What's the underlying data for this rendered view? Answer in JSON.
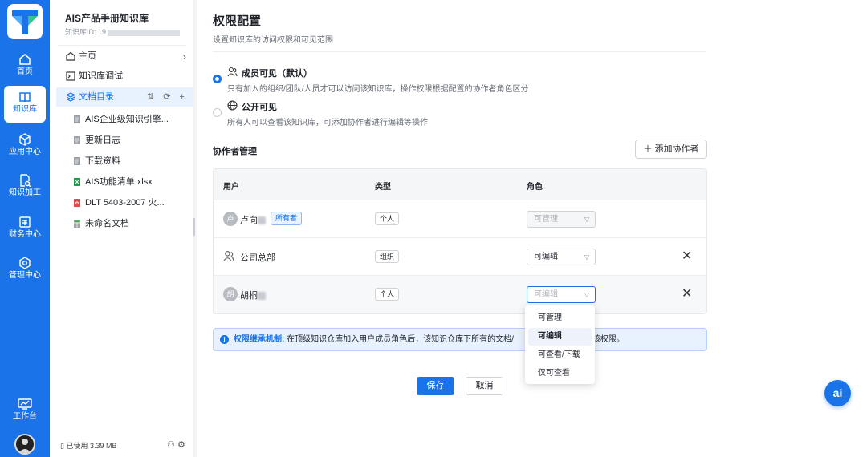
{
  "rail": {
    "items": [
      {
        "label": "首页",
        "icon": "home-icon"
      },
      {
        "label": "知识库",
        "icon": "book-icon",
        "active": true
      },
      {
        "label": "应用中心",
        "icon": "cube-icon"
      },
      {
        "label": "知识加工",
        "icon": "doc-search-icon"
      },
      {
        "label": "财务中心",
        "icon": "finance-icon"
      },
      {
        "label": "管理中心",
        "icon": "settings-icon"
      }
    ],
    "workbench": "工作台"
  },
  "kb": {
    "title": "AIS产品手册知识库",
    "id_label": "知识库ID: 19",
    "nav": {
      "home": "主页",
      "debug": "知识库调试",
      "catalog": "文档目录",
      "catalog_actions": "⇅ ⟳ +"
    },
    "docs": [
      {
        "name": "AIS企业级知识引擎...",
        "kind": "doc"
      },
      {
        "name": "更新日志",
        "kind": "doc"
      },
      {
        "name": "下载资料",
        "kind": "doc"
      },
      {
        "name": "AIS功能清单.xlsx",
        "kind": "excel"
      },
      {
        "name": "DLT 5403-2007 火...",
        "kind": "pdf"
      },
      {
        "name": "未命名文档",
        "kind": "sheet"
      }
    ],
    "usage": "已使用 3.39 MB"
  },
  "main": {
    "title": "权限配置",
    "subtitle": "设置知识库的访问权限和可见范围",
    "visibility": {
      "member": {
        "title": "成员可见（默认）",
        "desc": "只有加入的组织/团队/人员才可以访问该知识库，操作权限根据配置的协作者角色区分",
        "selected": true
      },
      "public": {
        "title": "公开可见",
        "desc": "所有人可以查看该知识库，可添加协作者进行编辑等操作",
        "selected": false
      }
    },
    "collab_title": "协作者管理",
    "add_button": "添加协作者",
    "table": {
      "headers": {
        "user": "用户",
        "type": "类型",
        "role": "角色"
      },
      "rows": [
        {
          "avatar": "卢",
          "name": "卢向",
          "badge": "所有者",
          "type": "个人",
          "role": "可管理"
        },
        {
          "name": "公司总部",
          "type": "组织",
          "role": "可编辑"
        },
        {
          "avatar": "胡",
          "name": "胡桐",
          "type": "个人",
          "role_placeholder": "可编辑"
        }
      ]
    },
    "notice": {
      "label": "权限继承机制:",
      "text_a": "在顶级知识仓库加入用户成员角色后，该知识仓库下所有的文档/",
      "text_b": "承该权限。"
    },
    "save": "保存",
    "cancel": "取消",
    "dropdown": [
      "可管理",
      "可编辑",
      "可查看/下载",
      "仅可查看"
    ],
    "dropdown_selected": 1,
    "ai_button": "ai"
  }
}
